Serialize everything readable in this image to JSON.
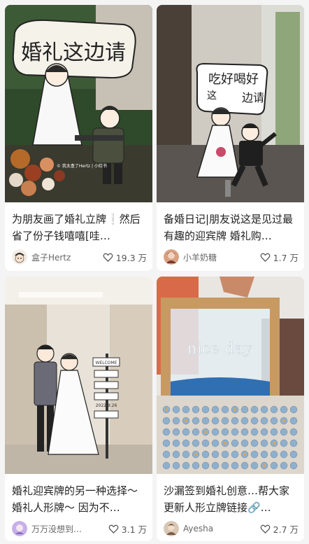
{
  "cards": [
    {
      "title": "为朋友画了婚礼立牌❕然后省了份子钱嘻嘻[哇…",
      "author": "盒子Hertz",
      "likes": "19.3 万",
      "sign_text": "婚礼这边请",
      "watermark": "© 我太盒了Hertz  |  小红书",
      "avatar_icon": "cartoon-face-icon"
    },
    {
      "title": "备婚日记|朋友说这是见过最有趣的迎宾牌 婚礼购…",
      "author": "小羊奶糖",
      "likes": "1.7 万",
      "sign_text_1": "吃好喝好",
      "sign_text_2": "这",
      "sign_text_3": "边请",
      "avatar_icon": "photo-avatar-icon"
    },
    {
      "title": "婚礼迎宾牌的另一种选择～婚礼人形牌～ 因为不…",
      "author": "万万没想到…",
      "likes": "3.1 万",
      "welcome_text": "WELCOME",
      "date_text": "2022.8.26",
      "avatar_icon": "purple-avatar-icon"
    },
    {
      "title": "沙漏签到婚礼创意…帮大家更新人形立牌链接🔗…",
      "author": "Ayesha",
      "likes": "2.7 万",
      "glass_text": "nice day",
      "avatar_icon": "photo-avatar-icon"
    }
  ],
  "colors": {
    "background": "#f4f4f4",
    "card": "#ffffff",
    "title_text": "#222222",
    "meta_text": "#666666"
  }
}
